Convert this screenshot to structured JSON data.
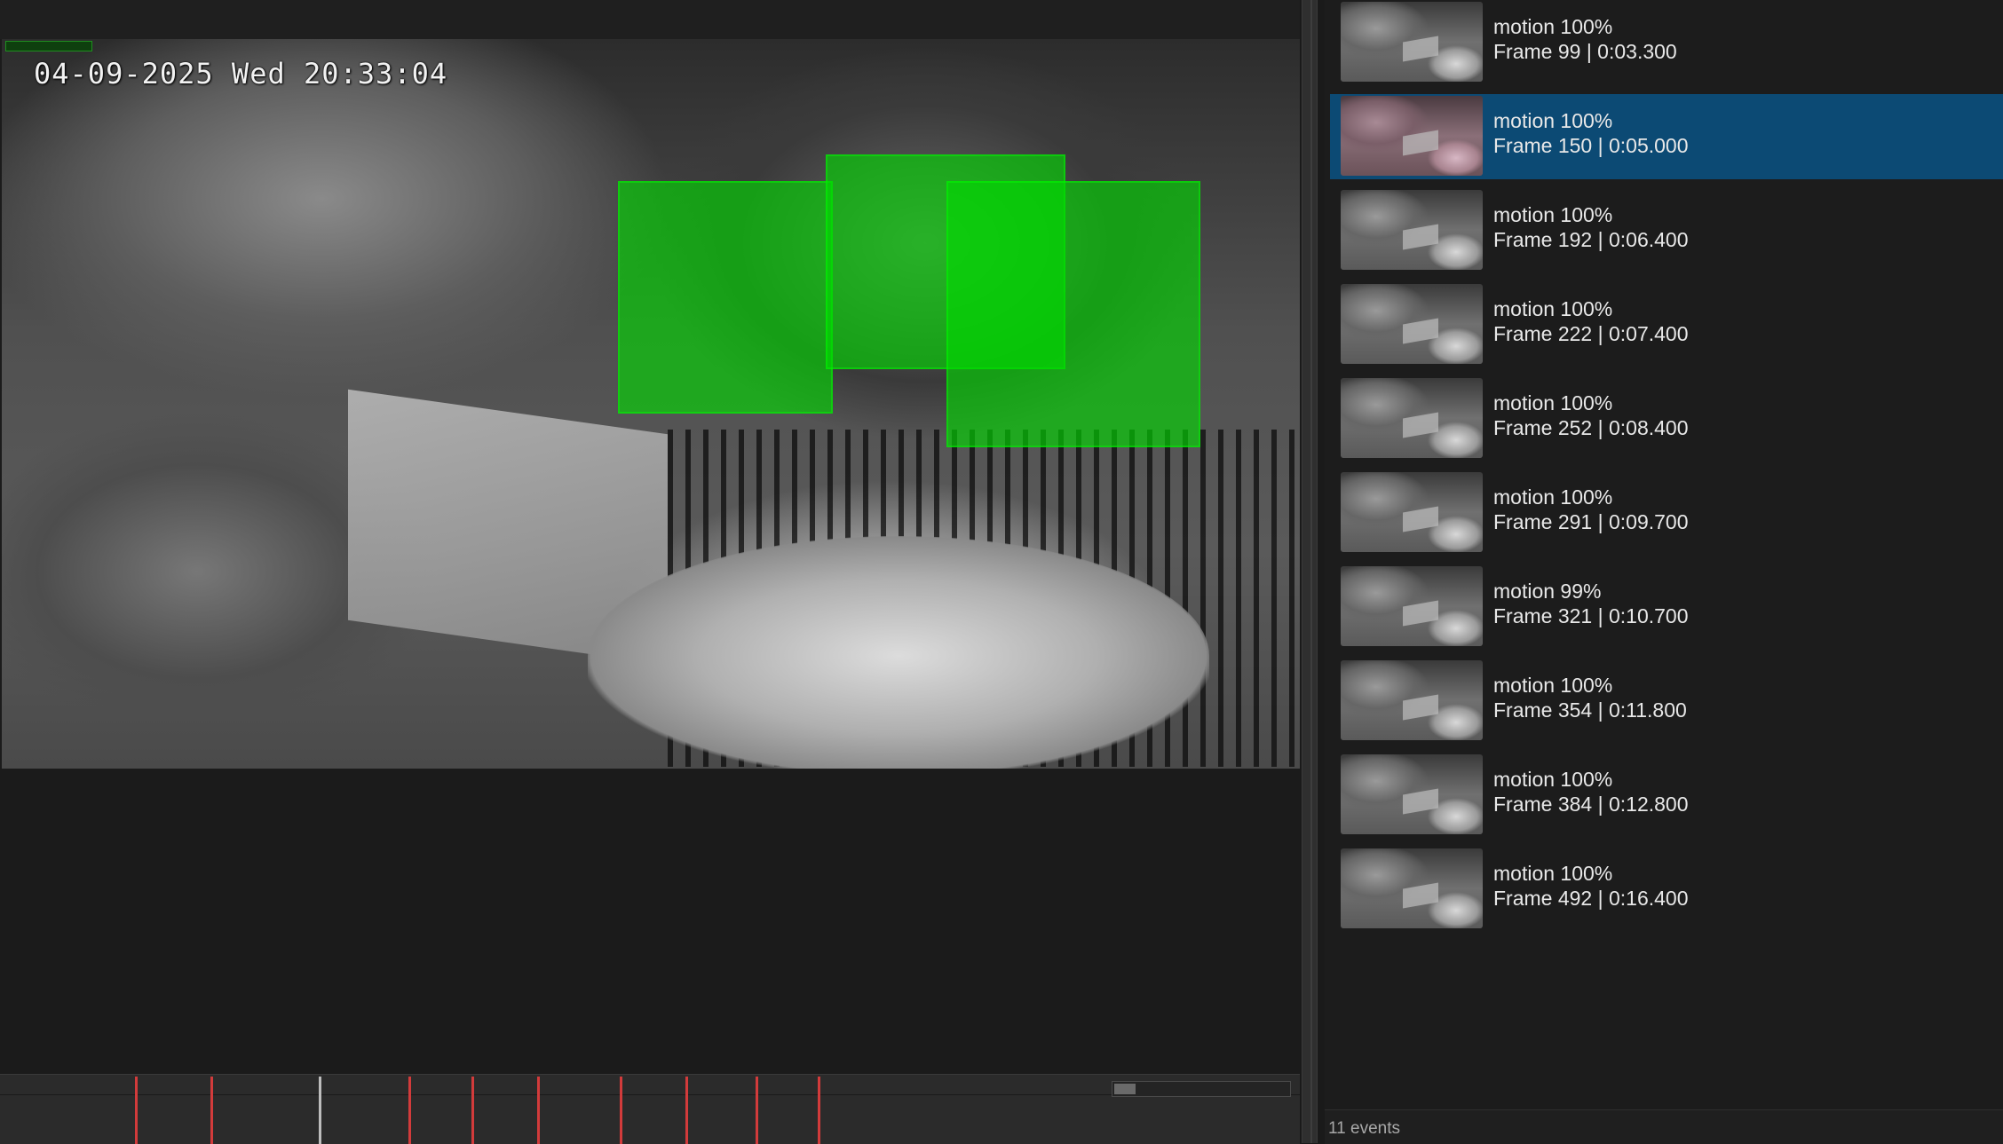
{
  "video": {
    "osd_timestamp": "04-09-2025 Wed 20:33:04"
  },
  "timeline": {
    "playhead_fraction": 0.245,
    "event_marker_fractions": [
      0.104,
      0.162,
      0.314,
      0.363,
      0.413,
      0.477,
      0.527,
      0.581,
      0.629
    ]
  },
  "events": {
    "selected_index": 1,
    "items": [
      {
        "label": "motion 100%",
        "detail": "Frame 99 | 0:03.300"
      },
      {
        "label": "motion 100%",
        "detail": "Frame 150 | 0:05.000"
      },
      {
        "label": "motion 100%",
        "detail": "Frame 192 | 0:06.400"
      },
      {
        "label": "motion 100%",
        "detail": "Frame 222 | 0:07.400"
      },
      {
        "label": "motion 100%",
        "detail": "Frame 252 | 0:08.400"
      },
      {
        "label": "motion 100%",
        "detail": "Frame 291 | 0:09.700"
      },
      {
        "label": "motion 99%",
        "detail": "Frame 321 | 0:10.700"
      },
      {
        "label": "motion 100%",
        "detail": "Frame 354 | 0:11.800"
      },
      {
        "label": "motion 100%",
        "detail": "Frame 384 | 0:12.800"
      },
      {
        "label": "motion 100%",
        "detail": "Frame 492 | 0:16.400"
      }
    ]
  },
  "status": {
    "event_count": "11 events"
  },
  "colors": {
    "selected_row": "#0c4a74",
    "event_marker": "#d23b3b",
    "detection_box": "#00dc00"
  }
}
